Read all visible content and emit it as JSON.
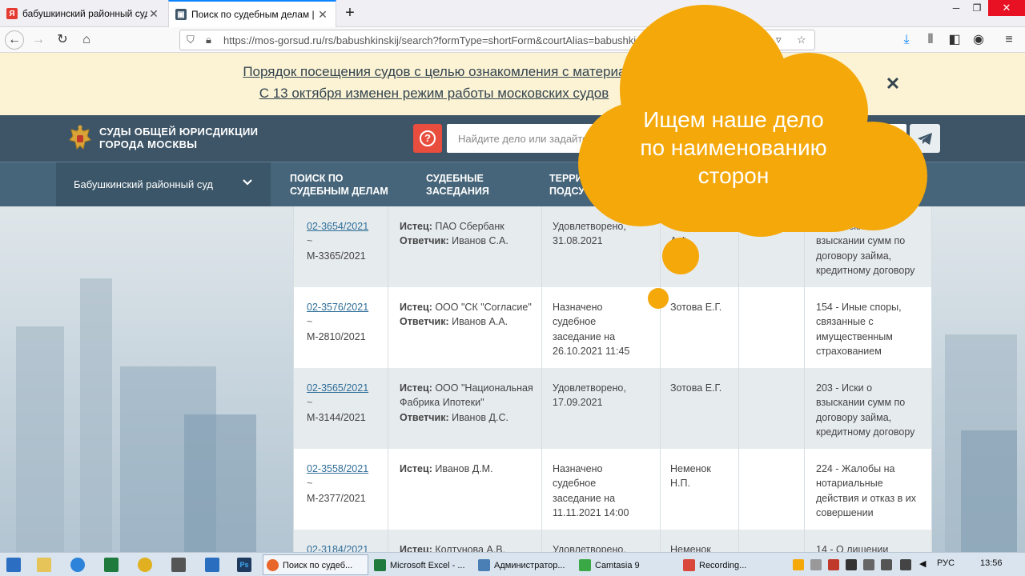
{
  "browser": {
    "tabs": [
      {
        "title": "бабушкинский районный суд",
        "favicon": "yandex-icon"
      },
      {
        "title": "Поиск по судебным делам | В",
        "favicon": "court-site-icon"
      }
    ],
    "url": "https://mos-gorsud.ru/rs/babushkinskij/search?formType=shortForm&courtAlias=babushki"
  },
  "banner": {
    "line1": "Порядок посещения судов с целью ознакомления с материалами д",
    "line2": "С 13 октября изменен режим работы московских судов"
  },
  "header": {
    "court_name_line1": "СУДЫ ОБЩЕЙ ЮРИСДИКЦИИ",
    "court_name_line2": "ГОРОДА МОСКВЫ",
    "search_placeholder": "Найдите дело или задайте"
  },
  "subnav": {
    "court": "Бабушкинский районный суд",
    "item1_line1": "ПОИСК ПО",
    "item1_line2": "СУДЕБНЫМ ДЕЛАМ",
    "item2_line1": "СУДЕБНЫЕ",
    "item2_line2": "ЗАСЕДАНИЯ",
    "item3_line1": "ТЕРРИ",
    "item3_line2": "ПОДСУ"
  },
  "callout": {
    "line1": "Ищем наше дело",
    "line2": "по наименованию",
    "line3": "сторон"
  },
  "rows": [
    {
      "case": "02-3654/2021",
      "sep": "~",
      "material": "М-3365/2021",
      "plaintiff_label": "Истец:",
      "plaintiff": " ПАО Сбербанк",
      "defendant_label": "Ответчик:",
      "defendant": " Иванов С.А.",
      "status_l1": "Удовлетворено,",
      "status_l2": "31.08.2021",
      "status_l3": "",
      "status_l4": "",
      "judge_l1": "А.Ф.",
      "judge_l2": "",
      "category_l1": "203 - Иски о",
      "category_l2": "взыскании сумм по",
      "category_l3": "договору займа,",
      "category_l4": "кредитному договору"
    },
    {
      "case": "02-3576/2021",
      "sep": "~",
      "material": "М-2810/2021",
      "plaintiff_label": "Истец:",
      "plaintiff": " ООО \"СК \"Согласие\"",
      "defendant_label": "Ответчик:",
      "defendant": " Иванов А.А.",
      "status_l1": "Назначено",
      "status_l2": "судебное",
      "status_l3": "заседание на",
      "status_l4": "26.10.2021 11:45",
      "judge_l1": "Зотова Е.Г.",
      "judge_l2": "",
      "category_l1": "154 - Иные споры,",
      "category_l2": "связанные с",
      "category_l3": "имущественным",
      "category_l4": "страхованием"
    },
    {
      "case": "02-3565/2021",
      "sep": "~",
      "material": "М-3144/2021",
      "plaintiff_label": "Истец:",
      "plaintiff": " ООО \"Национальная Фабрика Ипотеки\"",
      "defendant_label": "Ответчик:",
      "defendant": " Иванов Д.С.",
      "status_l1": "Удовлетворено,",
      "status_l2": "17.09.2021",
      "status_l3": "",
      "status_l4": "",
      "judge_l1": "Зотова Е.Г.",
      "judge_l2": "",
      "category_l1": "203 - Иски о",
      "category_l2": "взыскании сумм по",
      "category_l3": "договору займа,",
      "category_l4": "кредитному договору"
    },
    {
      "case": "02-3558/2021",
      "sep": "~",
      "material": "М-2377/2021",
      "plaintiff_label": "Истец:",
      "plaintiff": " Иванов Д.М.",
      "defendant_label": "",
      "defendant": "",
      "status_l1": "Назначено",
      "status_l2": "судебное",
      "status_l3": "заседание на",
      "status_l4": "11.11.2021 14:00",
      "judge_l1": "Неменок",
      "judge_l2": "Н.П.",
      "category_l1": "224 - Жалобы на",
      "category_l2": "нотариальные",
      "category_l3": "действия и отказ в их",
      "category_l4": "совершении"
    },
    {
      "case": "02-3184/2021",
      "sep": "",
      "material": "",
      "plaintiff_label": "Истец:",
      "plaintiff": " Колтунова А.В.",
      "defendant_label": "",
      "defendant": "",
      "status_l1": "Удовлетворено,",
      "status_l2": "",
      "status_l3": "",
      "status_l4": "",
      "judge_l1": "Неменок",
      "judge_l2": "",
      "category_l1": "14 - О лишении",
      "category_l2": "",
      "category_l3": "",
      "category_l4": ""
    }
  ],
  "taskbar": {
    "tasks": [
      "Поиск по судеб...",
      "Microsoft Excel - ...",
      "Администратор...",
      "Camtasia 9",
      "Recording..."
    ],
    "lang": "РУС",
    "time": "13:56"
  },
  "colors": {
    "accent": "#f5a80a",
    "header": "#3d5567",
    "banner": "#fbf3d4",
    "link": "#2f6e98"
  }
}
